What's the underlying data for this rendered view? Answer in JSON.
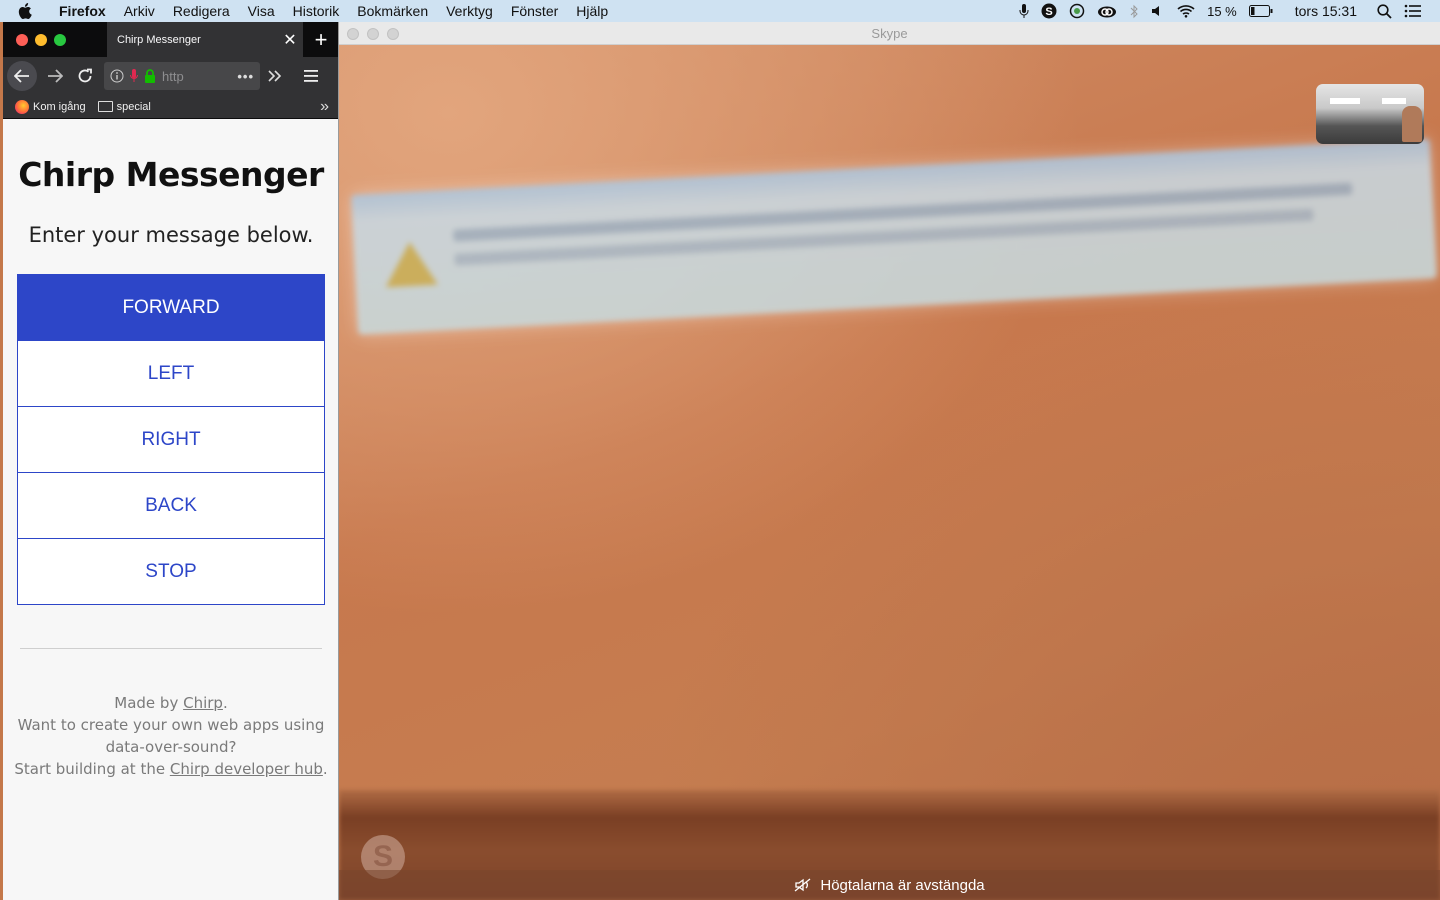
{
  "menubar": {
    "app_name": "Firefox",
    "items": [
      "Arkiv",
      "Redigera",
      "Visa",
      "Historik",
      "Bokmärken",
      "Verktyg",
      "Fönster",
      "Hjälp"
    ],
    "battery": "15 %",
    "clock": "tors 15:31"
  },
  "skype": {
    "window_title": "Skype",
    "speaker_notice": "Högtalarna är avstängda"
  },
  "firefox": {
    "tab_title": "Chirp Messenger",
    "url_text": "http",
    "bookmarks": [
      "Kom igång",
      "special"
    ]
  },
  "page": {
    "title": "Chirp Messenger",
    "subtitle": "Enter your message below.",
    "commands": [
      "FORWARD",
      "LEFT",
      "RIGHT",
      "BACK",
      "STOP"
    ],
    "footer": {
      "made_by_prefix": "Made by ",
      "made_by_link": "Chirp",
      "made_by_suffix": ".",
      "line2": "Want to create your own web apps using",
      "line3": "data-over-sound?",
      "line4_prefix": "Start building at the ",
      "line4_link": "Chirp developer hub",
      "line4_suffix": "."
    }
  },
  "colors": {
    "accent": "#2d46c8",
    "menubar": "#cfe2f2",
    "browser_chrome": "#323234"
  }
}
